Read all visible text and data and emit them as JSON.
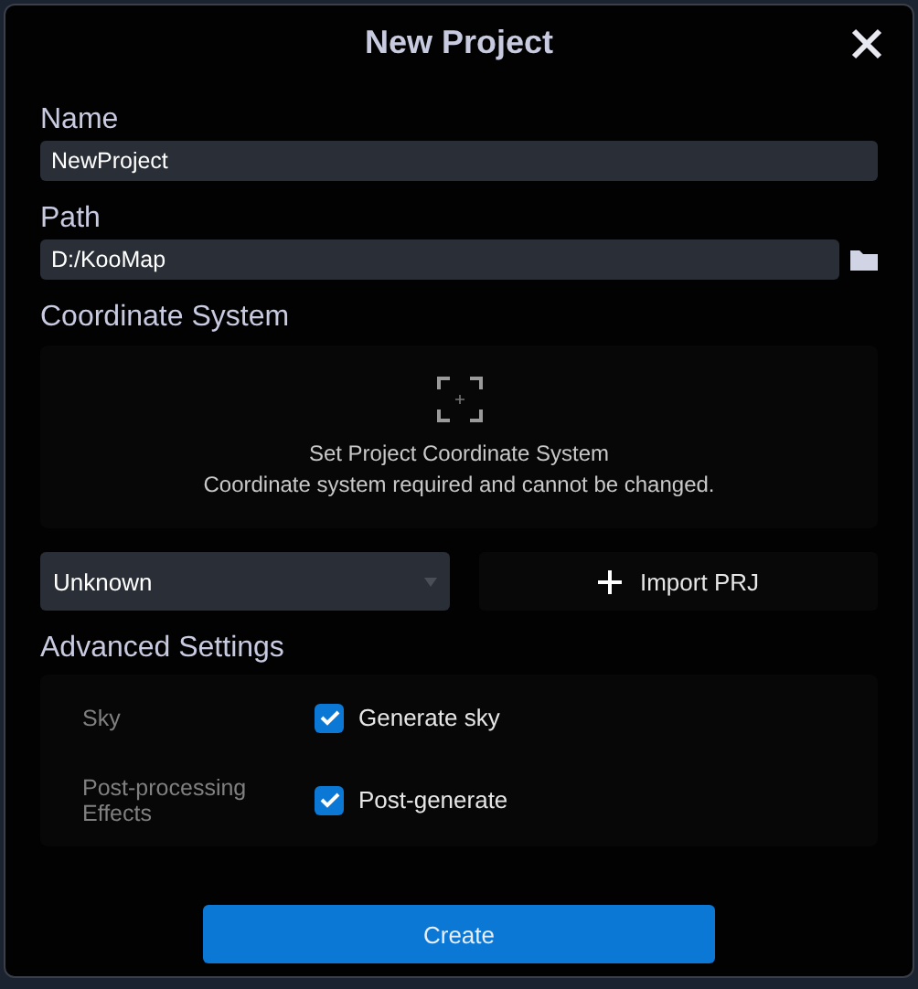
{
  "window": {
    "title": "New Project"
  },
  "name_field": {
    "label": "Name",
    "value": "NewProject"
  },
  "path_field": {
    "label": "Path",
    "value": "D:/KooMap"
  },
  "coordinate_system": {
    "heading": "Coordinate System",
    "prompt": "Set Project Coordinate System",
    "note": "Coordinate system required and cannot be changed.",
    "dropdown": {
      "value": "Unknown"
    },
    "import_button": {
      "label": "Import PRJ"
    }
  },
  "advanced_settings": {
    "heading": "Advanced Settings",
    "rows": [
      {
        "label": "Sky",
        "option": "Generate sky",
        "checked": true
      },
      {
        "label": "Post-processing Effects",
        "option": "Post-generate",
        "checked": true
      }
    ]
  },
  "create_button": {
    "label": "Create"
  }
}
